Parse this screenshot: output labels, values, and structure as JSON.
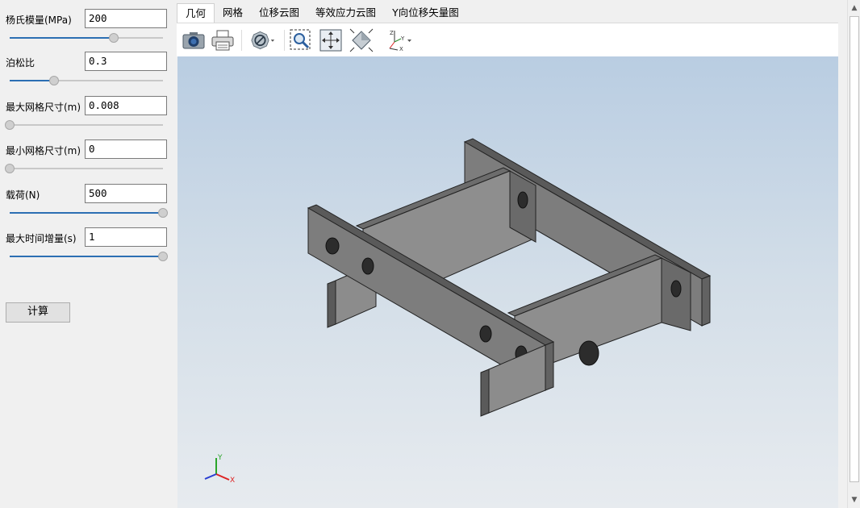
{
  "params": [
    {
      "label": "杨氏模量(MPa)",
      "value": "200",
      "slider_fraction": 0.68
    },
    {
      "label": "泊松比",
      "value": "0.3",
      "slider_fraction": 0.29
    },
    {
      "label": "最大网格尺寸(m)",
      "value": "0.008",
      "slider_fraction": 0.0
    },
    {
      "label": "最小网格尺寸(m)",
      "value": "0",
      "slider_fraction": 0.0
    },
    {
      "label": "载荷(N)",
      "value": "500",
      "slider_fraction": 1.0
    },
    {
      "label": "最大时间增量(s)",
      "value": "1",
      "slider_fraction": 1.0
    }
  ],
  "calc_button": "计算",
  "tabs": [
    "几何",
    "网格",
    "位移云图",
    "等效应力云图",
    "Y向位移矢量图"
  ],
  "active_tab": 0,
  "toolbar_icons": [
    "camera-icon",
    "printer-icon",
    "view-style-icon",
    "zoom-box-icon",
    "fit-all-icon",
    "iso-view-icon",
    "axis-view-icon"
  ],
  "axis_triad": {
    "x": "X",
    "y": "Y"
  },
  "toolbar_axis_labels": {
    "z": "Z",
    "y": "Y",
    "x": "X"
  },
  "colors": {
    "slider_fill": "#2c6fb3",
    "view_top": "#b9cde2",
    "view_bottom": "#e7ebef",
    "model_fill": "#7f7f7f"
  }
}
